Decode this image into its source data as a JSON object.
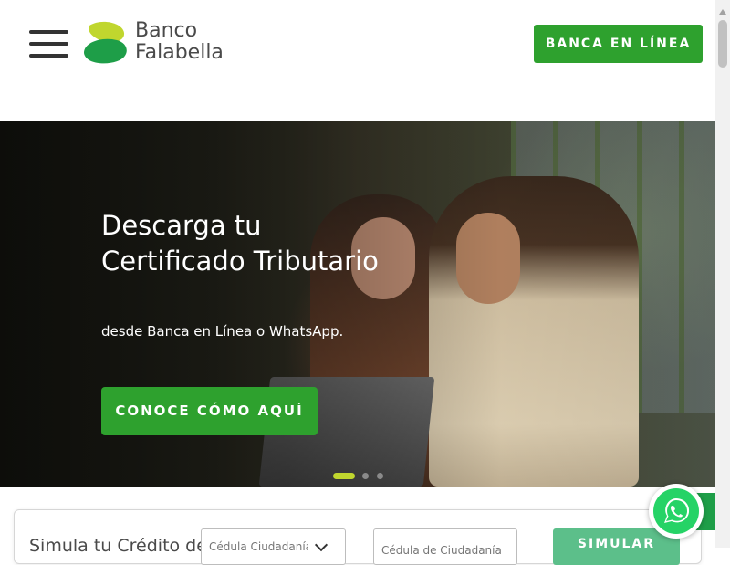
{
  "header": {
    "menu_icon": "hamburger-icon",
    "logo": {
      "line1": "Banco",
      "line2": "Falabella",
      "colors": {
        "dark_green": "#1e9e48",
        "light_green": "#c0d62e",
        "text": "#4a4a4a"
      }
    },
    "online_button": "BANCA EN LÍNEA"
  },
  "hero": {
    "title": "Descarga tu Certificado Tributario",
    "subtitle": "desde Banca en Línea o WhatsApp.",
    "cta": "CONOCE CÓMO AQUÍ",
    "slides_count": 3,
    "active_slide": 1
  },
  "simulator": {
    "title": "Simula tu Crédito de Consumo",
    "doc_type_selected": "Cédula Ciudadanía",
    "doc_number_placeholder": "Cédula de Ciudadanía",
    "submit": "SIMULAR"
  },
  "floating": {
    "whatsapp_icon": "whatsapp-icon"
  },
  "colors": {
    "accent": "#2ea12e",
    "simulate_button": "#5cbf8a",
    "active_dot": "#c0d62e"
  }
}
